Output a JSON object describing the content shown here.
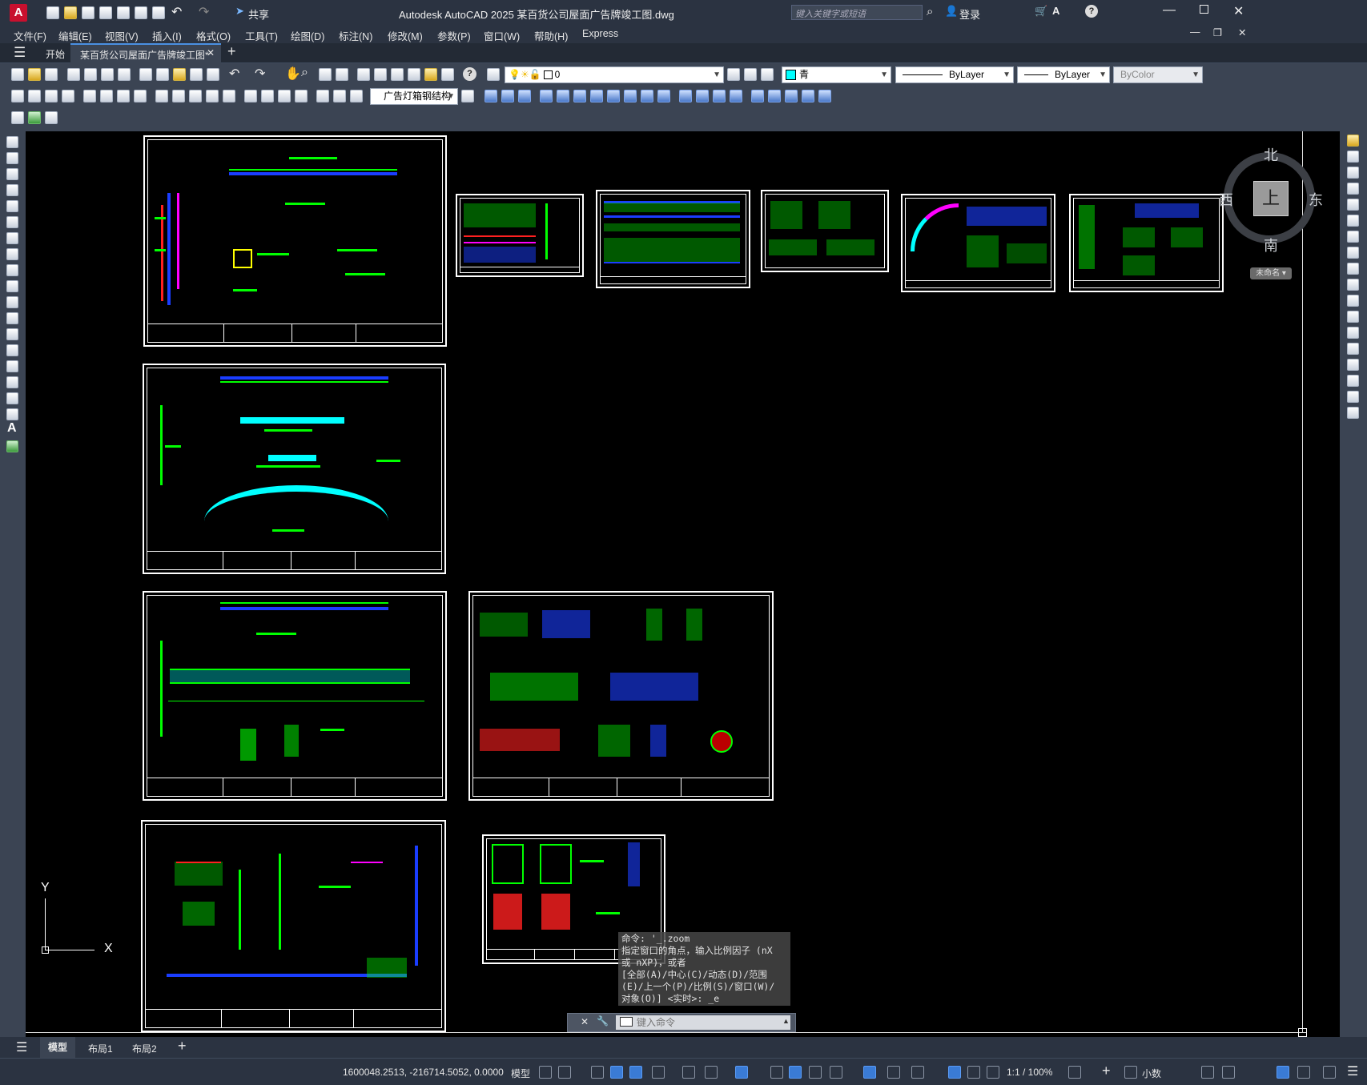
{
  "window": {
    "title": "Autodesk AutoCAD 2025    某百货公司屋面广告牌竣工图.dwg",
    "search_placeholder": "键入关键字或短语",
    "login": "登录",
    "share": "共享"
  },
  "menu": [
    "文件(F)",
    "编辑(E)",
    "视图(V)",
    "插入(I)",
    "格式(O)",
    "工具(T)",
    "绘图(D)",
    "标注(N)",
    "修改(M)",
    "参数(P)",
    "窗口(W)",
    "帮助(H)",
    "Express"
  ],
  "doc_tabs": {
    "start": "开始",
    "active": "某百货公司屋面广告牌竣工图*",
    "add": "+"
  },
  "toolbar": {
    "layer": "0",
    "color": "青",
    "linetype": "ByLayer",
    "lineweight": "ByLayer",
    "plotstyle": "ByColor",
    "dimstyle": "广告灯箱钢结构"
  },
  "viewcube": {
    "north": "北",
    "south": "南",
    "east": "东",
    "west": "西",
    "face": "上",
    "unnamed": "未命名"
  },
  "ucs": {
    "x": "X",
    "y": "Y"
  },
  "command": {
    "history": [
      "命令: '_.zoom",
      "指定窗口的角点，输入比例因子 (nX",
      "或 nXP)，或者",
      "[全部(A)/中心(C)/动态(D)/范围",
      "(E)/上一个(P)/比例(S)/窗口(W)/",
      "对象(O)] <实时>: _e"
    ],
    "placeholder": "键入命令"
  },
  "layouts": [
    "模型",
    "布局1",
    "布局2"
  ],
  "status": {
    "coords": "1600048.2513, -216714.5052, 0.0000",
    "mode": "模型",
    "scale": "1:1 / 100%",
    "units": "小数"
  }
}
